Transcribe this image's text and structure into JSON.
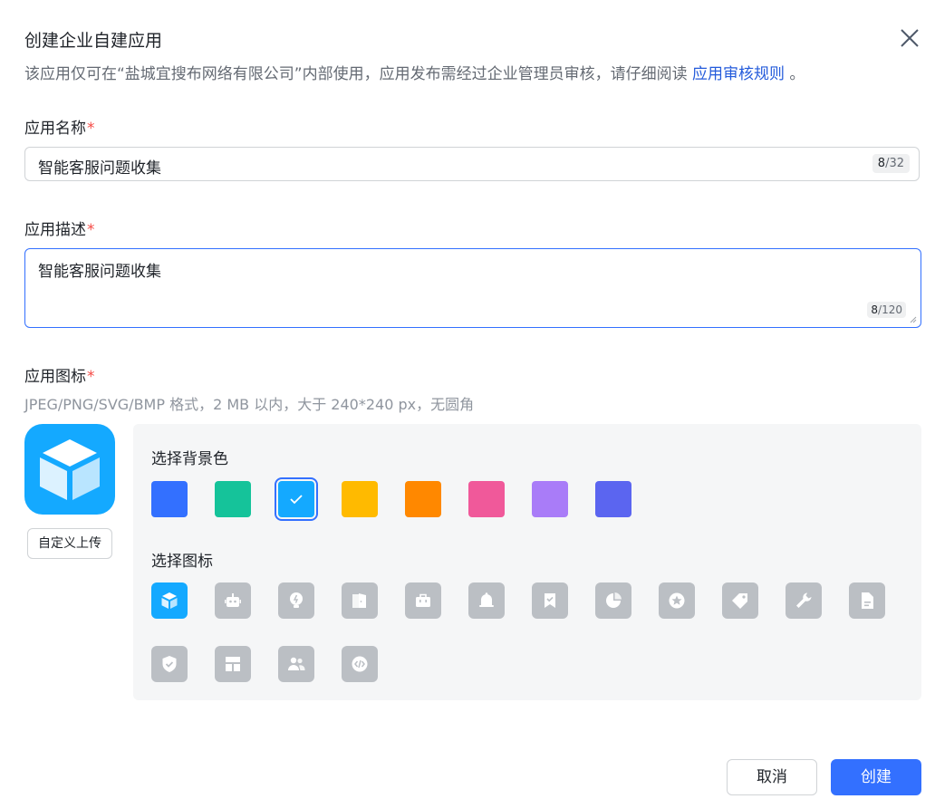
{
  "dialog": {
    "title": "创建企业自建应用",
    "subtitle_prefix": "该应用仅可在“盐城宜搜布网络有限公司”内部使用，应用发布需经过企业管理员审核，请仔细阅读 ",
    "subtitle_link": "应用审核规则",
    "subtitle_suffix": " 。"
  },
  "name_field": {
    "label": "应用名称",
    "required_mark": "*",
    "value": "智能客服问题收集",
    "count": "8",
    "max": "/32"
  },
  "desc_field": {
    "label": "应用描述",
    "required_mark": "*",
    "value": "智能客服问题收集",
    "count": "8",
    "max": "/120"
  },
  "icon_field": {
    "label": "应用图标",
    "required_mark": "*",
    "hint": "JPEG/PNG/SVG/BMP 格式，2 MB 以内，大于 240*240 px，无圆角",
    "upload_label": "自定义上传",
    "preview_icon": "cube-icon"
  },
  "bg_picker": {
    "title": "选择背景色",
    "selected_index": 2,
    "colors": [
      "#3370ff",
      "#15c39a",
      "#14a9ff",
      "#ffba00",
      "#ff8800",
      "#f0599a",
      "#a97cf8",
      "#5b65f0"
    ]
  },
  "icon_picker": {
    "title": "选择图标",
    "selected_index": 0,
    "icons": [
      "cube-icon",
      "robot-icon",
      "lightbulb-icon",
      "door-icon",
      "briefcase-icon",
      "bell-icon",
      "bookmark-check-icon",
      "pie-chart-icon",
      "star-icon",
      "tag-icon",
      "wrench-icon",
      "document-icon",
      "shield-check-icon",
      "layout-icon",
      "people-icon",
      "code-icon"
    ]
  },
  "footer": {
    "cancel_label": "取消",
    "create_label": "创建"
  }
}
